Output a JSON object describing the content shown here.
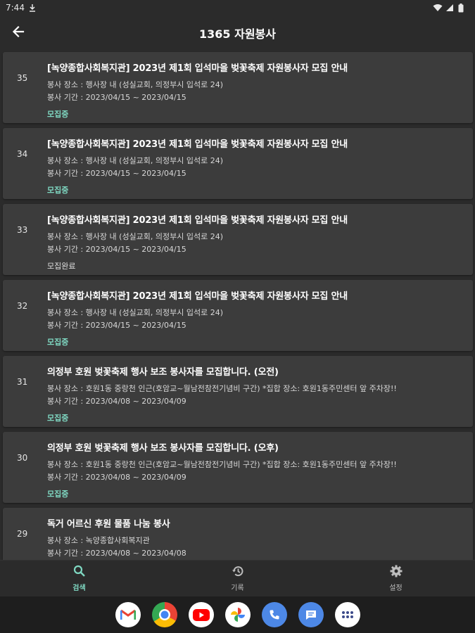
{
  "status_bar": {
    "time": "7:44"
  },
  "app_bar": {
    "title": "1365 자원봉사"
  },
  "colors": {
    "recruiting": "#7fd8c2",
    "closed": "#e0e0e0",
    "card_bg": "#3c3c3c",
    "bg": "#2b2b2b"
  },
  "list": {
    "items": [
      {
        "num": "35",
        "title": "[녹양종합사회복지관] 2023년 제1회 입석마을 벚꽃축제 자원봉사자 모집 안내",
        "place": "봉사 장소 : 행사장 내 (성실교회, 의정부시 입석로 24)",
        "period": "봉사 기간 : 2023/04/15 ~ 2023/04/15",
        "status": "모집중",
        "status_type": "recruiting"
      },
      {
        "num": "34",
        "title": "[녹양종합사회복지관] 2023년 제1회 입석마을 벚꽃축제 자원봉사자 모집 안내",
        "place": "봉사 장소 : 행사장 내 (성실교회, 의정부시 입석로 24)",
        "period": "봉사 기간 : 2023/04/15 ~ 2023/04/15",
        "status": "모집중",
        "status_type": "recruiting"
      },
      {
        "num": "33",
        "title": "[녹양종합사회복지관] 2023년 제1회 입석마을 벚꽃축제 자원봉사자 모집 안내",
        "place": "봉사 장소 : 행사장 내 (성실교회, 의정부시 입석로 24)",
        "period": "봉사 기간 : 2023/04/15 ~ 2023/04/15",
        "status": "모집완료",
        "status_type": "closed"
      },
      {
        "num": "32",
        "title": "[녹양종합사회복지관] 2023년 제1회 입석마을 벚꽃축제 자원봉사자 모집 안내",
        "place": "봉사 장소 : 행사장 내 (성실교회, 의정부시 입석로 24)",
        "period": "봉사 기간 : 2023/04/15 ~ 2023/04/15",
        "status": "모집중",
        "status_type": "recruiting"
      },
      {
        "num": "31",
        "title": "의정부 호원 벚꽃축제 행사 보조 봉사자를 모집합니다. (오전)",
        "place": "봉사 장소 : 호원1동 중랑천 인근(호암교~월남전참전기념비 구간) *집합 장소: 호원1동주민센터 앞 주차장!!",
        "period": "봉사 기간 : 2023/04/08 ~ 2023/04/09",
        "status": "모집중",
        "status_type": "recruiting"
      },
      {
        "num": "30",
        "title": "의정부 호원 벚꽃축제 행사 보조 봉사자를 모집합니다. (오후)",
        "place": "봉사 장소 : 호원1동 중랑천 인근(호암교~월남전참전기념비 구간) *집합 장소: 호원1동주민센터 앞 주차장!!",
        "period": "봉사 기간 : 2023/04/08 ~ 2023/04/09",
        "status": "모집중",
        "status_type": "recruiting"
      },
      {
        "num": "29",
        "title": "독거 어르신 후원 물품 나눔 봉사",
        "place": "봉사 장소 : 녹양종합사회복지관",
        "period": "봉사 기간 : 2023/04/08 ~ 2023/04/08",
        "status": "",
        "status_type": "recruiting"
      }
    ]
  },
  "bottom_nav": {
    "items": [
      {
        "label": "검색",
        "icon": "search-icon",
        "active": true
      },
      {
        "label": "기록",
        "icon": "history-icon",
        "active": false
      },
      {
        "label": "설정",
        "icon": "gear-icon",
        "active": false
      }
    ]
  },
  "taskbar": {
    "apps": [
      {
        "name": "gmail-icon"
      },
      {
        "name": "chrome-icon"
      },
      {
        "name": "youtube-icon"
      },
      {
        "name": "photos-icon"
      },
      {
        "name": "phone-icon"
      },
      {
        "name": "messages-icon"
      },
      {
        "name": "app-drawer-icon"
      }
    ]
  }
}
